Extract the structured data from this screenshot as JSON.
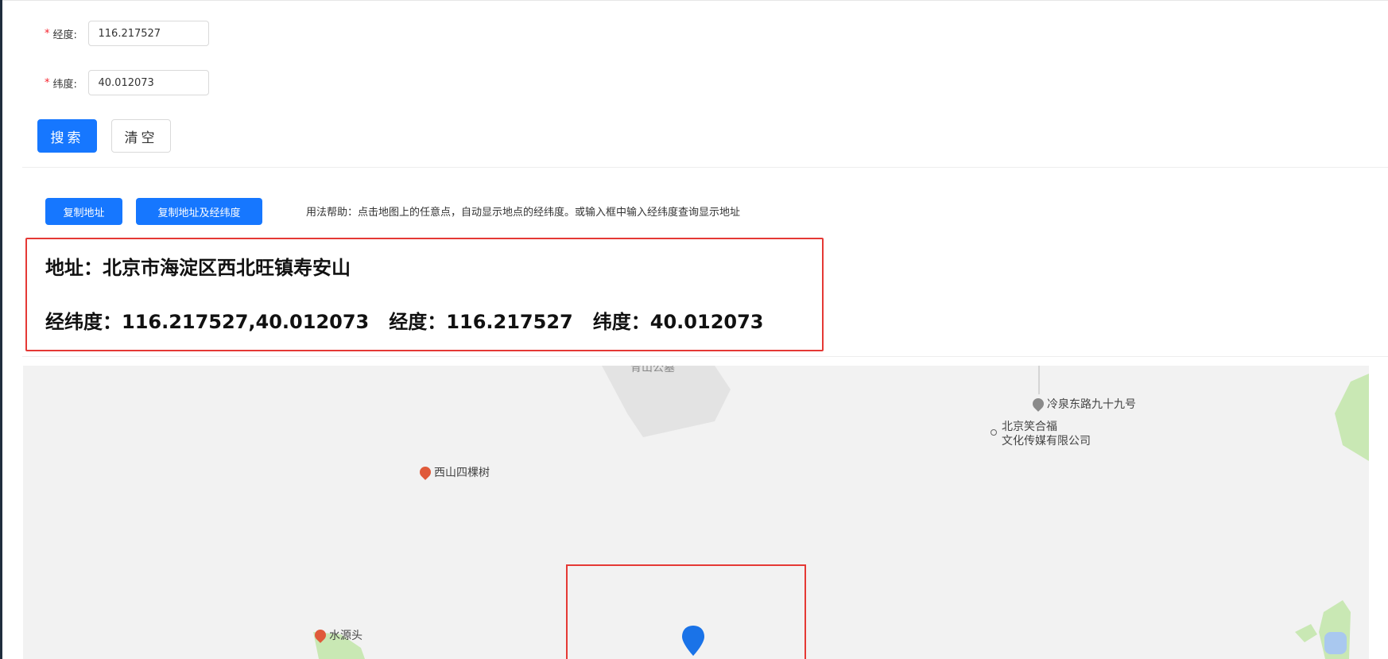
{
  "form": {
    "longitude": {
      "label": "经度:",
      "value": "116.217527"
    },
    "latitude": {
      "label": "纬度:",
      "value": "40.012073"
    },
    "search_label": "搜索",
    "clear_label": "清空"
  },
  "toolbar": {
    "copy_address_label": "复制地址",
    "copy_address_coords_label": "复制地址及经纬度",
    "help_text": "用法帮助：点击地图上的任意点，自动显示地点的经纬度。或输入框中输入经纬度查询显示地址"
  },
  "result": {
    "address_line": "地址：北京市海淀区西北旺镇寿安山",
    "coords_line": "经纬度：116.217527,40.012073   经度：116.217527   纬度：40.012073"
  },
  "map": {
    "pois": {
      "cemetery": "青山公墓",
      "road": "冷泉东路九十九号",
      "company_line1": "北京笑合福",
      "company_line2": "文化传媒有限公司",
      "tree": "西山四棵树",
      "spring": "水源头"
    },
    "colors": {
      "background": "#f2f2f2",
      "green": "#c9e8b4",
      "marker": "#1a73e8",
      "poi_red": "#e05a3a",
      "poi_gray": "#8a8a8a"
    }
  },
  "colors": {
    "primary": "#1677ff",
    "required": "#f5222d",
    "highlight_border": "#e53935"
  }
}
